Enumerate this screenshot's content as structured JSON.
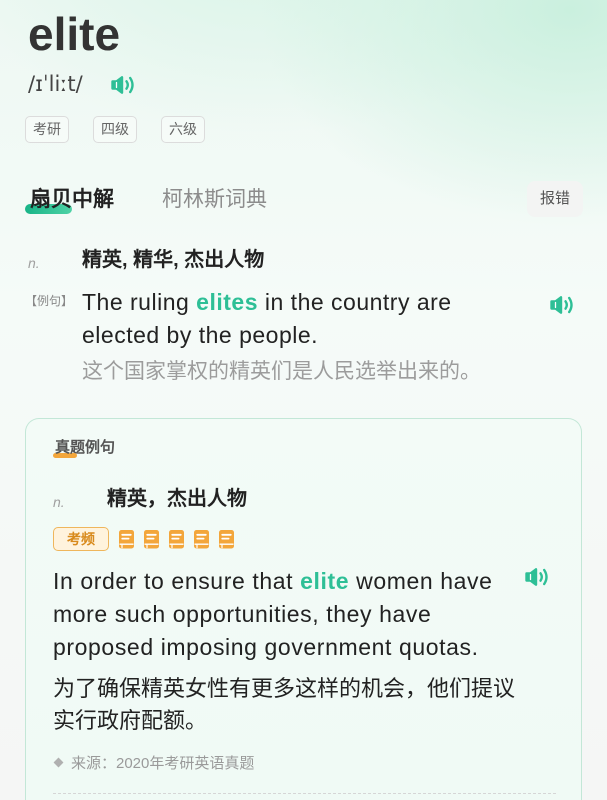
{
  "word": "elite",
  "phonetic": "/ɪˈliːt/",
  "tags": [
    "考研",
    "四级",
    "六级"
  ],
  "tabs": [
    {
      "label": "扇贝中解",
      "active": true
    },
    {
      "label": "柯林斯词典",
      "active": false
    }
  ],
  "report_button": "报错",
  "definition": {
    "pos": "n.",
    "meaning": "精英, 精华, 杰出人物",
    "example_label": "【例句】",
    "example": {
      "before": "The ruling ",
      "highlight": "elites",
      "after": " in the country are elected by the people."
    },
    "translation": "这个国家掌权的精英们是人民选举出来的。"
  },
  "exam_card": {
    "title": "真题例句",
    "pos": "n.",
    "meaning": "精英，杰出人物",
    "frequency_label": "考频",
    "frequency_level": 5,
    "sentence": {
      "before": "In order to ensure that ",
      "highlight": "elite",
      "after": " women have more such opportunities, they have proposed imposing government quotas."
    },
    "translation": "为了确保精英女性有更多这样的机会，他们提议实行政府配额。",
    "source": "来源：2020年考研英语真题"
  },
  "icons": {
    "pronounce": "speaker-icon",
    "frequency": "book-icon",
    "source_bullet": "diamond-icon"
  },
  "colors": {
    "accent": "#2ebf96",
    "frequency": "#f3a63b",
    "text": "#222222",
    "muted": "#999999"
  }
}
